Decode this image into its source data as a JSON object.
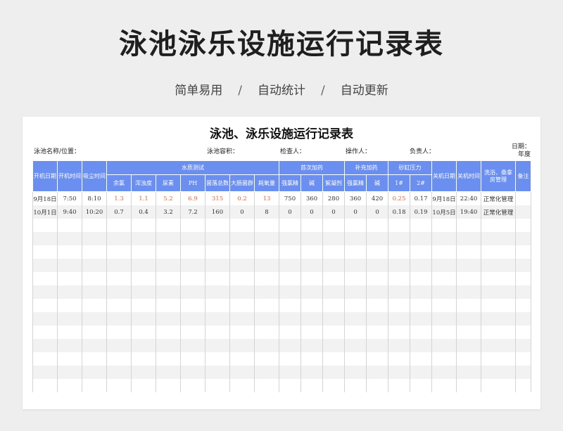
{
  "banner": {
    "title": "泳池泳乐设施运行记录表",
    "tags": [
      "简单易用",
      "自动统计",
      "自动更新"
    ],
    "separator": "/"
  },
  "sheet": {
    "title": "泳池、泳乐设施运行记录表",
    "info": {
      "pool_name_label": "泳池名称/位置：",
      "pool_volume_label": "泳池容积：",
      "inspector_label": "检查人：",
      "operator_label": "操作人：",
      "manager_label": "负责人：",
      "date_label": "日期：",
      "year_label": "年度"
    },
    "headers": {
      "start_date": "开机日期",
      "start_time": "开机时间",
      "vacuum_time": "吸尘时间",
      "water_test": "水质测试",
      "first_dose": "首次加药",
      "extra_dose": "补充加药",
      "sand_pressure": "砂缸压力",
      "stop_date": "关机日期",
      "stop_time": "关机时间",
      "bath_room": "洗浴、桑拿房管理",
      "remarks": "备注",
      "sub": {
        "residual_chlorine": "余氯",
        "turbidity": "浑浊度",
        "urea": "尿素",
        "ph": "PH",
        "bacteria": "菌落总数",
        "coliform": "大肠菌群",
        "oxygen_consumption": "耗氧量",
        "first_chlorine": "强氯精",
        "first_alkali": "碱",
        "flocculant": "絮凝剂",
        "extra_chlorine": "强氯精",
        "extra_alkali": "碱",
        "sand_1": "1#",
        "sand_2": "2#"
      }
    },
    "rows": [
      [
        "9月18日",
        "7:50",
        "8:10",
        "1.3",
        "1.1",
        "5.2",
        "6.9",
        "315",
        "0.2",
        "13",
        "750",
        "360",
        "280",
        "360",
        "420",
        "0.25",
        "0.17",
        "9月18日",
        "22:40",
        "正常化管理",
        ""
      ],
      [
        "10月1日",
        "9:40",
        "10:20",
        "0.7",
        "0.4",
        "3.2",
        "7.2",
        "160",
        "0",
        "8",
        "0",
        "0",
        "0",
        "0",
        "0",
        "0.18",
        "0.19",
        "10月5日",
        "19:40",
        "正常化管理",
        ""
      ]
    ],
    "highlight_color": "#e06a3c"
  }
}
